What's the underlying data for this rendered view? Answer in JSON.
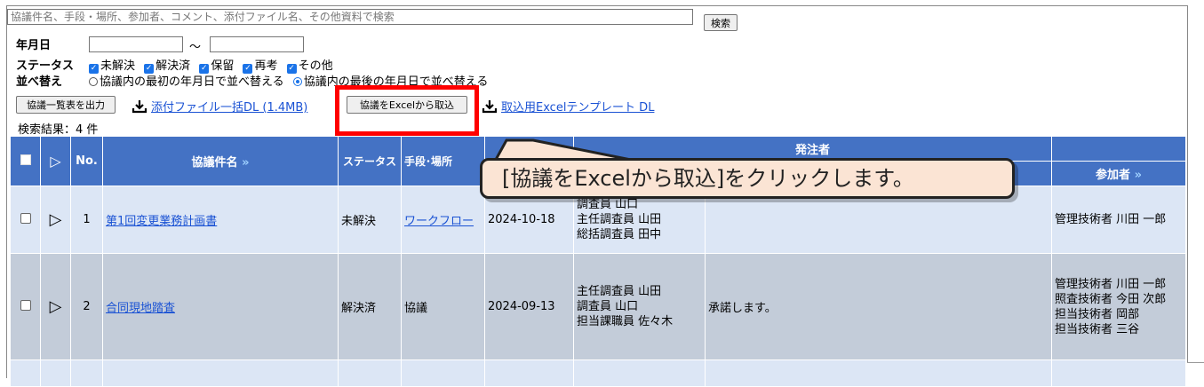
{
  "search": {
    "placeholder": "協議件名、手段・場所、参加者、コメント、添付ファイル名、その他資料で検索",
    "button": "検索"
  },
  "filters": {
    "date_label": "年月日",
    "date_sep": "～",
    "status_label": "ステータス",
    "statuses": [
      "未解決",
      "解決済",
      "保留",
      "再考",
      "その他"
    ],
    "sort_label": "並べ替え",
    "sort_options": [
      "協議内の最初の年月日で並べ替える",
      "協議内の最後の年月日で並べ替える"
    ]
  },
  "toolbar": {
    "export_list": "協議一覧表を出力",
    "attachments_dl": "添付ファイル一括DL (1.4MB)",
    "import_excel": "協議をExcelから取込",
    "template_dl": "取込用Excelテンプレート DL"
  },
  "results": "検索結果：4 件",
  "table": {
    "headers": {
      "no": "No.",
      "title": "協議件名",
      "title_sort": "»",
      "status": "ステータス",
      "means": "手段･場所",
      "orderer": "発注者",
      "participants": "参加者",
      "participants_sort": "»"
    },
    "rows": [
      {
        "no": "1",
        "title": "第1回変更業務計画書",
        "status": "未解決",
        "means": "ワークフロー",
        "date": "2024-10-18",
        "people": [
          "調査員 山口",
          "主任調査員 山田",
          "総括調査員 田中"
        ],
        "comment": "",
        "participants": [
          "管理技術者 川田 一郎"
        ]
      },
      {
        "no": "2",
        "title": "合同現地踏査",
        "status": "解決済",
        "means": "協議",
        "date": "2024-09-13",
        "people": [
          "主任調査員 山田",
          "調査員 山口",
          "担当課職員 佐々木"
        ],
        "comment": "承諾します。",
        "participants": [
          "管理技術者 川田 一郎",
          "照査技術者 今田 次郎",
          "担当技術者 岡部",
          "担当技術者 三谷"
        ]
      }
    ]
  },
  "callout": "[協議をExcelから取込]をクリックします。",
  "colors": {
    "header_bg": "#4472c4",
    "row_light": "#dce6f5",
    "row_dark": "#c3ccd9",
    "highlight": "#ff0000",
    "callout_bg": "#fbe4d4"
  }
}
